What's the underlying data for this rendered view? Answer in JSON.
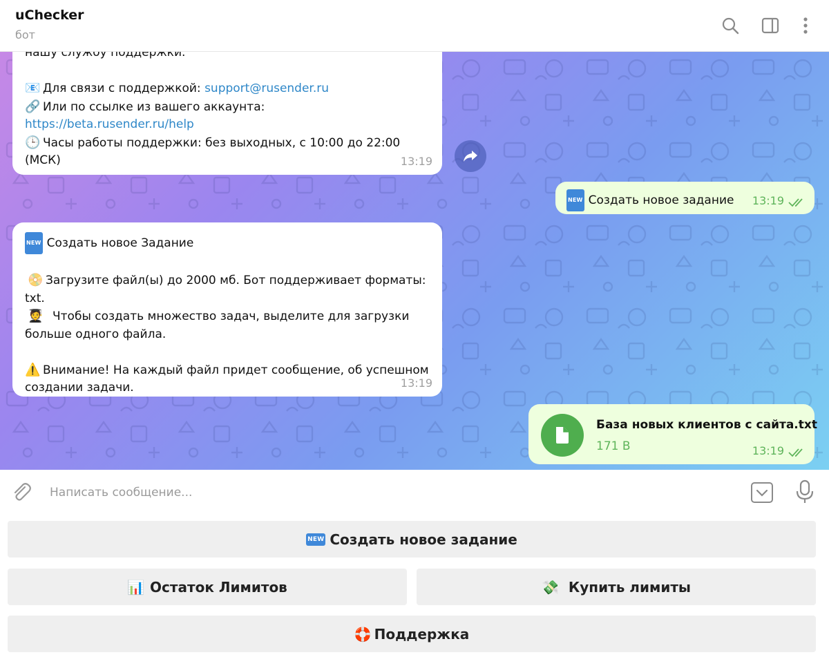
{
  "header": {
    "title": "uChecker",
    "subtitle": "бот",
    "icons": [
      "search-icon",
      "sidebar-toggle-icon",
      "more-vertical-icon"
    ]
  },
  "messages": {
    "support_bubble": {
      "line_partial": "нашу службу поддержки.",
      "contact_label": "Для связи с поддержкой: ",
      "contact_email": "support@rusender.ru",
      "link_label": "Или по ссылке из вашего аккаунта:",
      "link_url": "https://beta.rusender.ru/help",
      "hours_text": "Часы работы поддержки: без выходных, с 10:00 до 22:00 (МСК)",
      "time": "13:19",
      "emojis": {
        "mail": "📧",
        "link": "🔗",
        "clock": "🕒"
      }
    },
    "outgoing_1": {
      "badge": "NEW",
      "text": "Создать новое задание",
      "time": "13:19"
    },
    "task_bubble": {
      "badge": "NEW",
      "title": "Создать новое Задание",
      "upload_text": "Загрузите файл(ы) до 2000 мб. Бот поддерживает форматы: txt.",
      "multi_text": "Чтобы создать множество задач, выделите для загрузки больше одного файла.",
      "warning_text": "Внимание! На каждый файл придет сообщение, об успешном создании задачи.",
      "time": "13:19",
      "emojis": {
        "disc": "📀",
        "student": "🧑‍🎓",
        "warning": "⚠️"
      }
    },
    "file_message": {
      "filename": "База новых клиентов с сайта.txt",
      "size": "171 B",
      "time": "13:19"
    }
  },
  "composer": {
    "placeholder": "Написать сообщение..."
  },
  "keyboard": {
    "create_task": {
      "badge": "NEW",
      "label": "Создать новое задание"
    },
    "limits_left": {
      "emoji": "📊",
      "label": "Остаток Лимитов"
    },
    "buy_limits": {
      "emoji": "💸",
      "label": "Купить лимиты"
    },
    "support": {
      "emoji": "🛟",
      "label": "Поддержка"
    }
  },
  "colors": {
    "link": "#2e87c8",
    "outgoing_bubble": "#eeffde",
    "read_ticks": "#5eb45a",
    "file_icon": "#4fae4e",
    "new_badge": "#3f88d9"
  }
}
